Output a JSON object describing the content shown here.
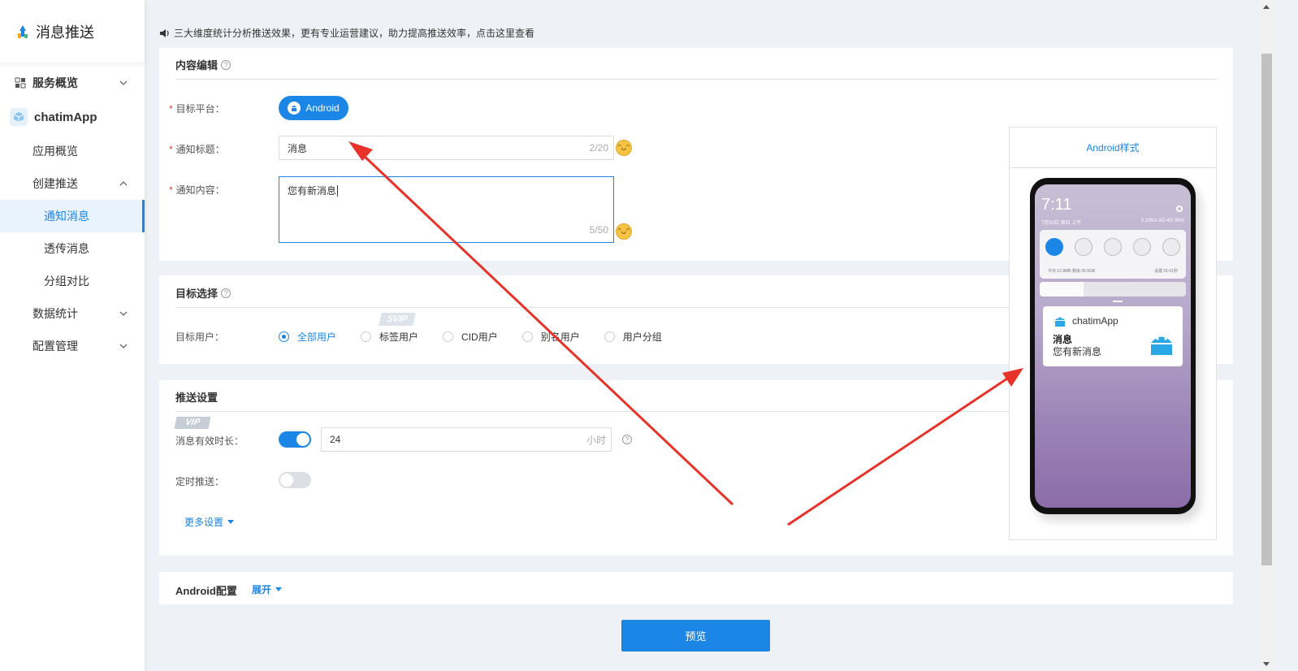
{
  "brand": {
    "title": "消息推送"
  },
  "sidebar": {
    "overview": "服务概览",
    "app_name": "chatimApp",
    "items": [
      {
        "label": "应用概览"
      },
      {
        "label": "创建推送"
      },
      {
        "label": "通知消息",
        "active": true
      },
      {
        "label": "透传消息"
      },
      {
        "label": "分组对比"
      },
      {
        "label": "数据统计"
      },
      {
        "label": "配置管理"
      }
    ]
  },
  "notice": "三大维度统计分析推送效果，更有专业运营建议，助力提高推送效率，点击这里查看",
  "content_edit": {
    "title": "内容编辑",
    "platform_label": "目标平台：",
    "platform_value": "Android",
    "notify_title_label": "通知标题：",
    "notify_title_value": "消息",
    "notify_title_count": "2/20",
    "notify_content_label": "通知内容：",
    "notify_content_value": "您有新消息",
    "notify_content_count": "5/50"
  },
  "target": {
    "title": "目标选择",
    "users_label": "目标用户：",
    "badge": "SVIP",
    "options": [
      "全部用户",
      "标签用户",
      "CID用户",
      "别名用户",
      "用户分组"
    ],
    "selected": "全部用户"
  },
  "push_settings": {
    "title": "推送设置",
    "badge": "VIP",
    "ttl_label": "消息有效时长：",
    "ttl_value": "24",
    "ttl_unit": "小时",
    "ttl_enabled": true,
    "schedule_label": "定时推送：",
    "schedule_enabled": false,
    "more": "更多设置"
  },
  "android_config": {
    "title": "Android配置",
    "expand": "展开"
  },
  "preview_button": "预览",
  "phone_preview": {
    "title": "Android样式",
    "clock": "7:11",
    "date": "7月10日 周日 上午",
    "status": "0.10K/s 5G 4G 96%",
    "data_left": "今日:12.8MB 剩余:35.5GB",
    "data_right": "设置 01:01秒",
    "notif_app": "chatimApp",
    "notif_title": "消息",
    "notif_body": "您有新消息"
  },
  "colors": {
    "accent": "#1b86e5",
    "required": "#e84a4a",
    "arrow": "#e8332a"
  }
}
